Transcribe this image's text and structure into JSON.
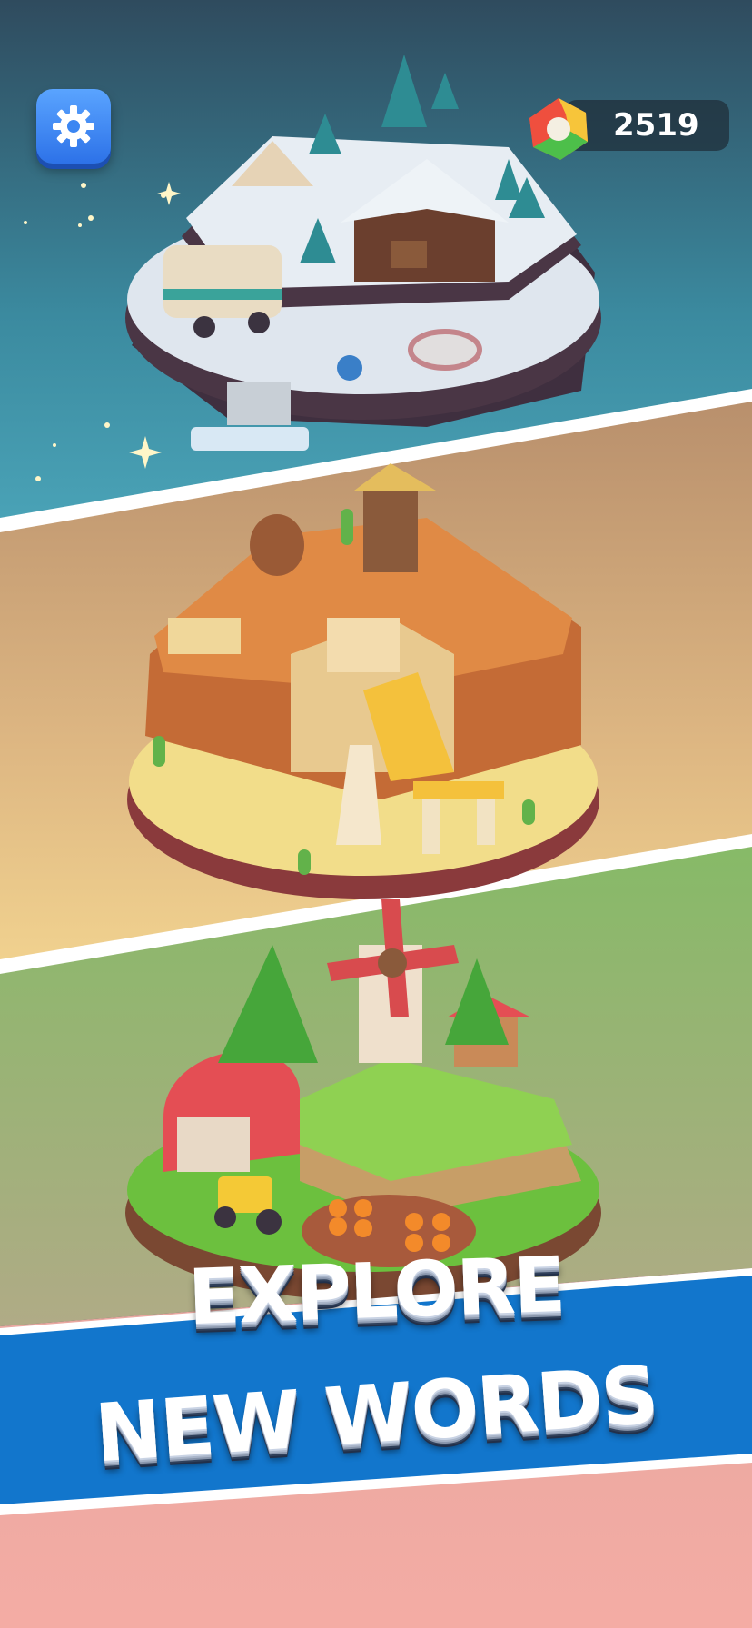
{
  "hud": {
    "coin_count": "2519",
    "settings_icon": "gear-icon",
    "currency_icon": "ring-coin-icon"
  },
  "promo": {
    "line1": "EXPLORE",
    "line2": "NEW WORDS"
  },
  "scenes": [
    {
      "theme": "snow-camp",
      "icon": "snow-island-scene"
    },
    {
      "theme": "desert-temple",
      "icon": "desert-island-scene"
    },
    {
      "theme": "farm",
      "icon": "farm-island-scene"
    }
  ],
  "colors": {
    "settings_button": "#3b86f2",
    "banner_blue": "#1276cc",
    "bottom_pink": "#f4aaa2",
    "coin_text": "#ffffff"
  }
}
